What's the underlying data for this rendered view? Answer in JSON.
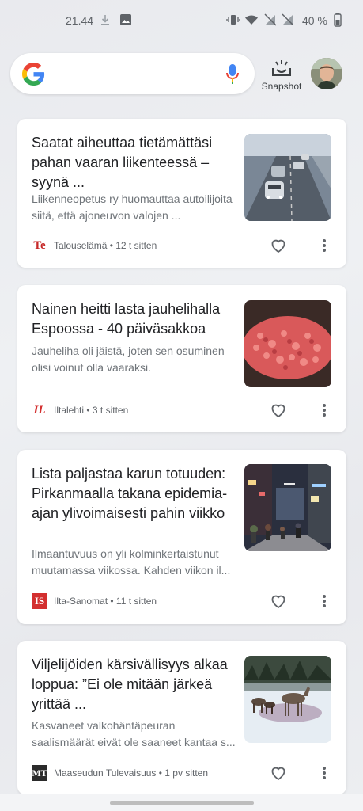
{
  "status_bar": {
    "time": "21.44",
    "battery": "40 %"
  },
  "search": {
    "snapshot_label": "Snapshot"
  },
  "colors": {
    "google_blue": "#4285F4",
    "google_red": "#EA4335",
    "google_yellow": "#FBBC05",
    "google_green": "#34A853"
  },
  "feed": [
    {
      "title": "Saatat aiheuttaa tietämättäsi pahan vaaran liikenteessä – syynä ...",
      "snippet": "Liikenneopetus ry huomauttaa autoilijoita siitä, että ajoneuvon valojen ...",
      "source_logo": "Te",
      "source": "Talouselämä",
      "time": "12 t sitten",
      "thumb_icon": "traffic-photo"
    },
    {
      "title": "Nainen heitti lasta jauhelihalla Espoossa - 40 päiväsakkoa",
      "snippet": "Jauheliha oli jäistä, joten sen osuminen olisi voinut olla vaaraksi.",
      "source_logo": "IL",
      "source": "Iltalehti",
      "time": "3 t sitten",
      "thumb_icon": "minced-meat-photo"
    },
    {
      "title": "Lista paljastaa karun totuuden: Pirkanmaalla takana epidemia-ajan ylivoimaisesti pahin viikko",
      "snippet": "Ilmaantuvuus on yli kolminkertaistunut muutamassa viikossa. Kahden viikon il...",
      "source_logo": "IS",
      "source": "Ilta-Sanomat",
      "time": "11 t sitten",
      "thumb_icon": "street-photo"
    },
    {
      "title": "Viljelijöiden kärsivällisyys alkaa loppua: ”Ei ole mitään järkeä yrittää ...",
      "snippet": "Kasvaneet valkohäntäpeuran saalismäärät eivät ole saaneet kantaa s...",
      "source_logo": "MT",
      "source": "Maaseudun Tulevaisuus",
      "time": "1 pv sitten",
      "thumb_icon": "deer-photo"
    }
  ]
}
